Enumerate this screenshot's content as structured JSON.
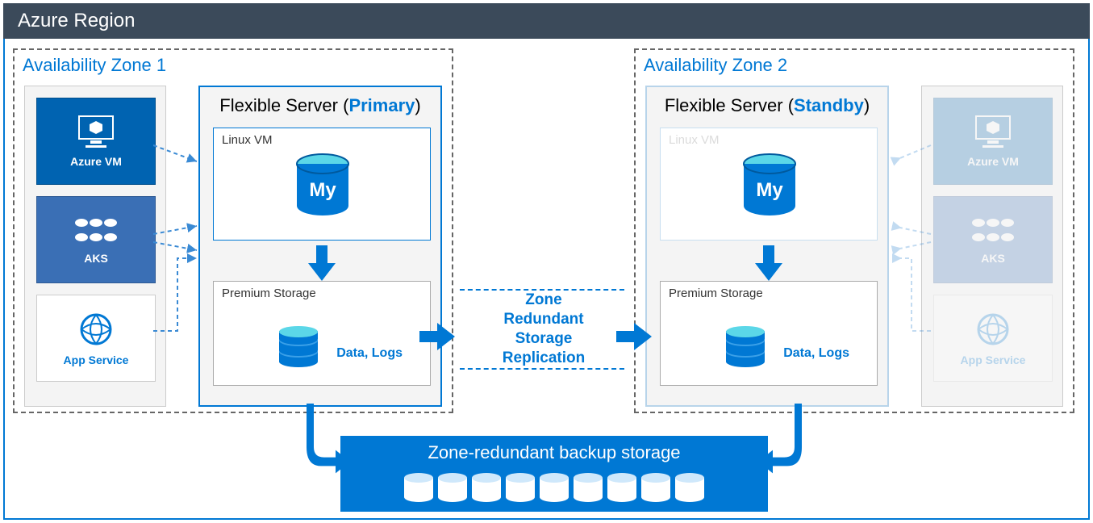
{
  "region": {
    "title": "Azure Region"
  },
  "az1": {
    "title": "Availability Zone 1",
    "clients": {
      "vm": "Azure VM",
      "aks": "AKS",
      "app": "App Service"
    },
    "server": {
      "title_prefix": "Flexible Server (",
      "role": "Primary",
      "title_suffix": ")",
      "linux": "Linux VM",
      "storage": "Premium Storage",
      "datalog": "Data, Logs"
    }
  },
  "az2": {
    "title": "Availability Zone 2",
    "clients": {
      "vm": "Azure VM",
      "aks": "AKS",
      "app": "App Service"
    },
    "server": {
      "title_prefix": "Flexible Server (",
      "role": "Standby",
      "title_suffix": ")",
      "linux": "Linux VM",
      "storage": "Premium Storage",
      "datalog": "Data, Logs"
    }
  },
  "replication": {
    "line1": "Zone",
    "line2": "Redundant",
    "line3": "Storage",
    "line4": "Replication"
  },
  "backup": {
    "title": "Zone-redundant backup storage"
  }
}
